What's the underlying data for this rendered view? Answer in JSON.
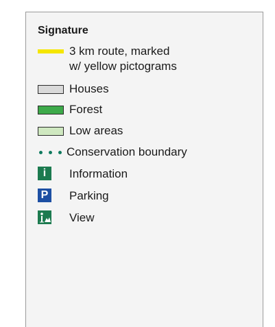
{
  "legend": {
    "title": "Signature",
    "items": [
      {
        "key": "route",
        "label_line1": "3 km route, marked",
        "label_line2": "w/ yellow pictograms",
        "color": "#f5e600"
      },
      {
        "key": "houses",
        "label": "Houses",
        "color": "#d9d9d9"
      },
      {
        "key": "forest",
        "label": "Forest",
        "color": "#3daa4a"
      },
      {
        "key": "low-areas",
        "label": "Low areas",
        "color": "#cfe8c0"
      },
      {
        "key": "conservation-boundary",
        "label": "Conservation boundary",
        "color": "#0f7a5f"
      },
      {
        "key": "information",
        "label": "Information",
        "icon": "information-icon",
        "glyph": "i",
        "color": "#1c7a4f"
      },
      {
        "key": "parking",
        "label": "Parking",
        "icon": "parking-icon",
        "glyph": "P",
        "color": "#1d4fa3"
      },
      {
        "key": "view",
        "label": "View",
        "icon": "viewpoint-icon",
        "color": "#1c7a4f"
      }
    ]
  }
}
